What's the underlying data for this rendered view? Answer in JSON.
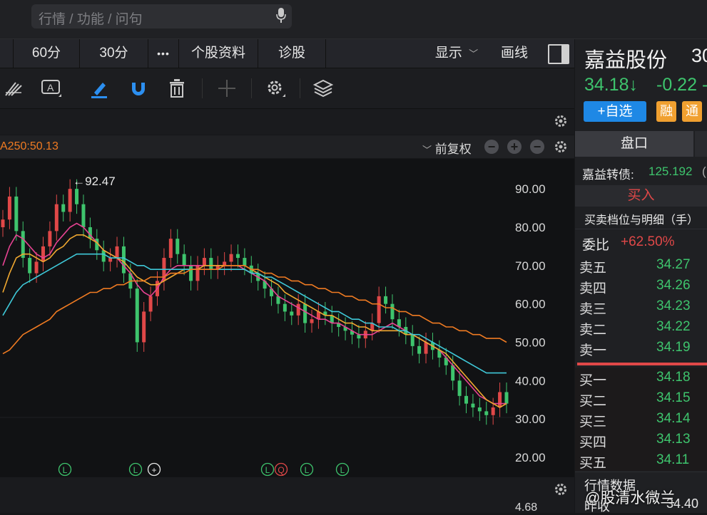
{
  "search": {
    "placeholder": "行情 / 功能 / 问句"
  },
  "periods": {
    "p60": "60分",
    "p30": "30分",
    "more": "•••",
    "profile": "个股资料",
    "diagnose": "诊股",
    "display": "显示",
    "draw": "画线"
  },
  "ma_row": {
    "ma_text": "A250:50.13",
    "adjust": "前复权"
  },
  "chart_data": {
    "type": "candlestick",
    "y_ticks": [
      "90.00",
      "80.00",
      "70.00",
      "60.00",
      "50.00",
      "40.00",
      "30.00",
      "20.00"
    ],
    "ylim": [
      20,
      93
    ],
    "high_annotation": "←92.47",
    "bottom_value": "4.68",
    "close_series": [
      82,
      88,
      79,
      72,
      68,
      71,
      75,
      79,
      86,
      84,
      90,
      86,
      80,
      77,
      74,
      71,
      72,
      75,
      68,
      64,
      50,
      58,
      62,
      66,
      72,
      77,
      73,
      70,
      66,
      70,
      72,
      69,
      70,
      71,
      73,
      72,
      70,
      68,
      66,
      64,
      62,
      60,
      58,
      57,
      60,
      55,
      56,
      58,
      57,
      55,
      54,
      53,
      52,
      51,
      53,
      55,
      62,
      60,
      56,
      54,
      52,
      49,
      47,
      50,
      48,
      46,
      44,
      40,
      36,
      34,
      33,
      32,
      31,
      33,
      37,
      34
    ],
    "ma_lines": [
      {
        "color": "#e84393",
        "values": [
          70,
          75,
          78,
          77,
          75,
          73,
          72,
          73,
          76,
          78,
          80,
          81,
          80,
          78,
          76,
          74,
          73,
          72,
          70,
          68,
          65,
          63,
          62,
          64,
          67,
          69,
          70,
          70,
          70,
          70,
          70,
          70,
          70,
          70,
          70,
          70,
          69,
          68,
          67,
          66,
          64,
          62,
          61,
          60,
          59,
          58,
          57,
          56,
          56,
          55,
          55,
          54,
          53,
          52,
          52,
          52,
          53,
          54,
          55,
          54,
          53,
          52,
          51,
          50,
          49,
          48,
          46,
          44,
          42,
          40,
          38,
          36,
          35,
          34,
          34,
          34
        ]
      },
      {
        "color": "#f0a830",
        "values": [
          63,
          68,
          72,
          73,
          73,
          72,
          71,
          72,
          74,
          75,
          77,
          78,
          78,
          77,
          76,
          74,
          73,
          72,
          71,
          69,
          67,
          66,
          65,
          65,
          66,
          67,
          68,
          69,
          69,
          69,
          70,
          70,
          70,
          70,
          70,
          70,
          70,
          69,
          68,
          67,
          66,
          65,
          63,
          62,
          61,
          60,
          59,
          58,
          57,
          57,
          56,
          55,
          55,
          54,
          54,
          53,
          53,
          53,
          53,
          53,
          52,
          52,
          51,
          50,
          49,
          48,
          47,
          45,
          43,
          41,
          39,
          37,
          35,
          34,
          33,
          34
        ]
      },
      {
        "color": "#3fc8d8",
        "values": [
          57,
          60,
          63,
          65,
          66,
          67,
          68,
          69,
          70,
          71,
          72,
          73,
          73,
          73,
          73,
          73,
          72,
          72,
          72,
          71,
          70,
          70,
          69,
          69,
          69,
          69,
          69,
          69,
          69,
          69,
          69,
          69,
          69,
          69,
          69,
          69,
          69,
          68,
          68,
          67,
          67,
          66,
          65,
          64,
          63,
          62,
          61,
          60,
          59,
          58,
          58,
          57,
          56,
          56,
          55,
          55,
          54,
          54,
          54,
          53,
          53,
          52,
          52,
          51,
          50,
          49,
          48,
          47,
          46,
          45,
          44,
          43,
          42,
          42,
          42,
          42
        ]
      },
      {
        "color": "#f07b22",
        "values": [
          47,
          48,
          50,
          52,
          53,
          54,
          55,
          56,
          58,
          59,
          60,
          61,
          62,
          63,
          63,
          64,
          64,
          65,
          65,
          66,
          66,
          66,
          67,
          67,
          67,
          68,
          68,
          68,
          69,
          69,
          69,
          69,
          69,
          70,
          70,
          70,
          70,
          69,
          69,
          68,
          68,
          67,
          67,
          66,
          66,
          65,
          65,
          64,
          64,
          63,
          63,
          62,
          62,
          61,
          61,
          60,
          60,
          59,
          59,
          58,
          58,
          57,
          57,
          56,
          55,
          55,
          54,
          54,
          53,
          53,
          52,
          52,
          51,
          51,
          51,
          50
        ]
      }
    ],
    "markers": [
      "L",
      "L",
      "+",
      "L",
      "Q",
      "L",
      "L"
    ]
  },
  "right": {
    "name": "嘉益股份",
    "code_fragment": "30",
    "price": "34.18↓",
    "change": "-0.22",
    "change_cut": "-",
    "add_watch": "+自选",
    "tag_rong": "融",
    "tag_tong": "通",
    "tab_pankou": "盘口",
    "convertible_label": "嘉益转债:",
    "convertible_value": "125.192",
    "convertible_cut": "(",
    "buy_banner": "买入",
    "detail_title": "买卖档位与明细（手）",
    "weibi_label": "委比",
    "weibi_value": "+62.50%",
    "asks": [
      {
        "label": "卖五",
        "price": "34.27"
      },
      {
        "label": "卖四",
        "price": "34.26"
      },
      {
        "label": "卖三",
        "price": "34.23"
      },
      {
        "label": "卖二",
        "price": "34.22"
      },
      {
        "label": "卖一",
        "price": "34.19"
      }
    ],
    "bids": [
      {
        "label": "买一",
        "price": "34.18"
      },
      {
        "label": "买二",
        "price": "34.15"
      },
      {
        "label": "买三",
        "price": "34.14"
      },
      {
        "label": "买四",
        "price": "34.13"
      },
      {
        "label": "买五",
        "price": "34.11"
      }
    ],
    "market_data": "行情数据",
    "prev_close_label": "昨收",
    "prev_close_value": "34.40"
  },
  "watermark": "@股清水微兰",
  "colors": {
    "up": "#e04848",
    "down": "#3ec46d",
    "accent": "#1e88e5",
    "orange": "#f07b22"
  }
}
